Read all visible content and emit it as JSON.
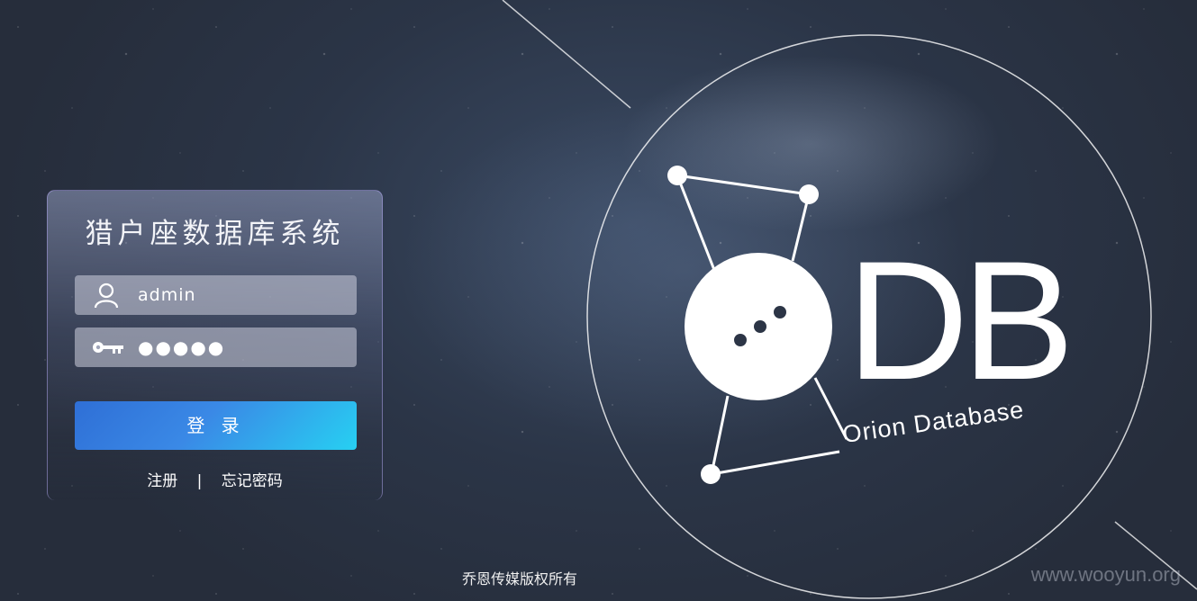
{
  "app": {
    "title": "猎户座数据库系统"
  },
  "login": {
    "username_value": "admin",
    "password_value": "●●●●●",
    "submit_label": "登 录",
    "register_label": "注册",
    "separator": "|",
    "forgot_label": "忘记密码"
  },
  "logo": {
    "letters": "DB",
    "subtitle": "Orion Database"
  },
  "footer": {
    "copyright": "乔恩传媒版权所有",
    "watermark": "www.wooyun.org"
  },
  "icons": {
    "username": "user-icon",
    "password": "key-icon"
  },
  "colors": {
    "button_start": "#2f6fd6",
    "button_end": "#27d0f2",
    "panel_border": "#aaa0e6"
  }
}
